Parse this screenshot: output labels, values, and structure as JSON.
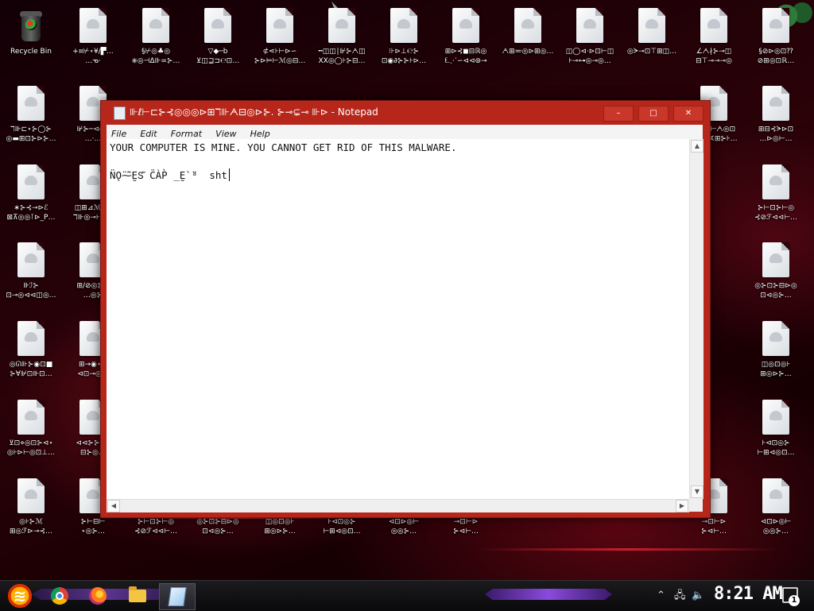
{
  "desktop": {
    "recycle_bin_label": "Recycle Bin",
    "icons": [
      {
        "l1": "+¤⊬⋆¥/▛…",
        "l2": "…ᓀ·"
      },
      {
        "l1": "§⊬◎♣◎",
        "l2": "⎈◎⊣∆⊪=⊱…"
      },
      {
        "l1": "▽◆─b",
        "l2": "⊻◫⊒⊐℮⊡…"
      },
      {
        "l1": "⊄⋖⊦⊢⊳∽",
        "l2": "⊱⊳⊨⊢ℳ◎⊟…"
      },
      {
        "l1": "╍◫◫∣⊮⊱ᗅ◫",
        "l2": "XX◎◯⊦⊱⊟…"
      },
      {
        "l1": "⁝⊦⊳⊥℮⊱",
        "l2": "⊡◉∂⊱⊱⊦⊳…"
      },
      {
        "l1": "⊞⊳⊰◼⊟ℝ◎",
        "l2": "ᘍ⋰∽⊲⊲⊚⊸"
      },
      {
        "l1": "ᗅ⊞≕◎⊳⊞◎…",
        "l2": ""
      },
      {
        "l1": "◫◯⊲⋅⊳⊡⊢◫",
        "l2": "⊦⊸⊶◎⊸◎…"
      },
      {
        "l1": "◎ᗒ⊸⊡⊤⊞◫…",
        "l2": ""
      },
      {
        "l1": "∠ᗅ∤⊱⊸◫",
        "l2": "⊟⊤⊸⊸⊸◎"
      },
      {
        "l1": "§⊘⊳◎⊡⁇",
        "l2": "⊘⊞◎⊡ℝ…"
      }
    ],
    "row2": [
      {
        "l1": "ℸ⊪⊏⋆⊱◯⊱",
        "l2": "◎▬⊞⊡⊱⊳⊱…"
      },
      {
        "l1": "⊮⊱─⊲◎⊺",
        "l2": "…⋅…"
      },
      {
        "l1": "⊞⊳⊳⊢ᗅ◎⊡",
        "l2": "◉⊞⊸∢⊞⊱⊦…"
      },
      {
        "l1": "⊞⊟⊰ᗒ⊳⊡",
        "l2": "…⊳◎⊢…"
      }
    ],
    "left_col": [
      {
        "l1": "∗⊱⊰⊸⊳ℰ",
        "l2": "⊠⊼◎◎⊺⊳_P…"
      },
      {
        "l1": "⊪ℐ⊱",
        "l2": "⊡⊸◎⊲⊲◫◎…"
      },
      {
        "l1": "◎ᘏ⊪⊱◉⊡■",
        "l2": "⊱∀⊮⊡⊪⊡…"
      },
      {
        "l1": "⊻⊡⋄◎⊡⊱⊲⋆",
        "l2": "◎⊦⊳⊢◎⊡⊥…"
      },
      {
        "l1": "◎⊦⊱ℳ",
        "l2": "⊞◎ℱ⊳⊸⊰…"
      }
    ],
    "left_col2": [
      {
        "l1": "◫⊞⊿ℳ⋆⊰",
        "l2": "ℸ⊪◎⊸⊦⊱…"
      },
      {
        "l1": "⊞/⊘◎⊱⊡",
        "l2": "…◎⊱"
      },
      {
        "l1": "⊞→◉⋆⊸",
        "l2": "⊲⊡⊸◎…"
      },
      {
        "l1": "⊲⊲⊱⊱⊲⋆",
        "l2": "⊟⊱◎…"
      },
      {
        "l1": "⊱⊢⊟⊢",
        "l2": "⋆◎⊱…"
      }
    ],
    "right_col": [
      {
        "l1": "⊱⊢⊡⊱⊢◎",
        "l2": "⊰⊘ℱ⊲⊲⊢…"
      },
      {
        "l1": "◎⊱⊡⊱⊟⊳◎",
        "l2": "⊡⊲◎⊱…"
      },
      {
        "l1": "◫◎⊡◎⊦",
        "l2": "⊞◎⊳⊱…"
      },
      {
        "l1": "⊦⊲⊡◎⊱",
        "l2": "⊢⊞⊲◎⊡…"
      },
      {
        "l1": "⊲⊡⊳◎⊢",
        "l2": "◎◎⊱…"
      },
      {
        "l1": "⊸⊡⊢⊳",
        "l2": "⊱⊲⊢…"
      }
    ]
  },
  "notepad": {
    "title": "⊪ℓ⊢⊏⊱⊰◎◎◎⊳⊞ℸ⊪ᗅ⊟◎⊳⊱. ⊱⊸⊊⊸  ⊪⊳ - Notepad",
    "menu": [
      "File",
      "Edit",
      "Format",
      "View",
      "Help"
    ],
    "line1": "YOUR COMPUTER IS MINE. YOU CANNOT GET RID OF THIS MALWARE.",
    "line2": "N̈Ǫ̈⁓͂ḚS͂ C̈ÀP̀ ̲Ḛ̀ ̈ᵃ  sht"
  },
  "taskbar": {
    "clock": "8:21 AM",
    "notification_count": "1"
  }
}
